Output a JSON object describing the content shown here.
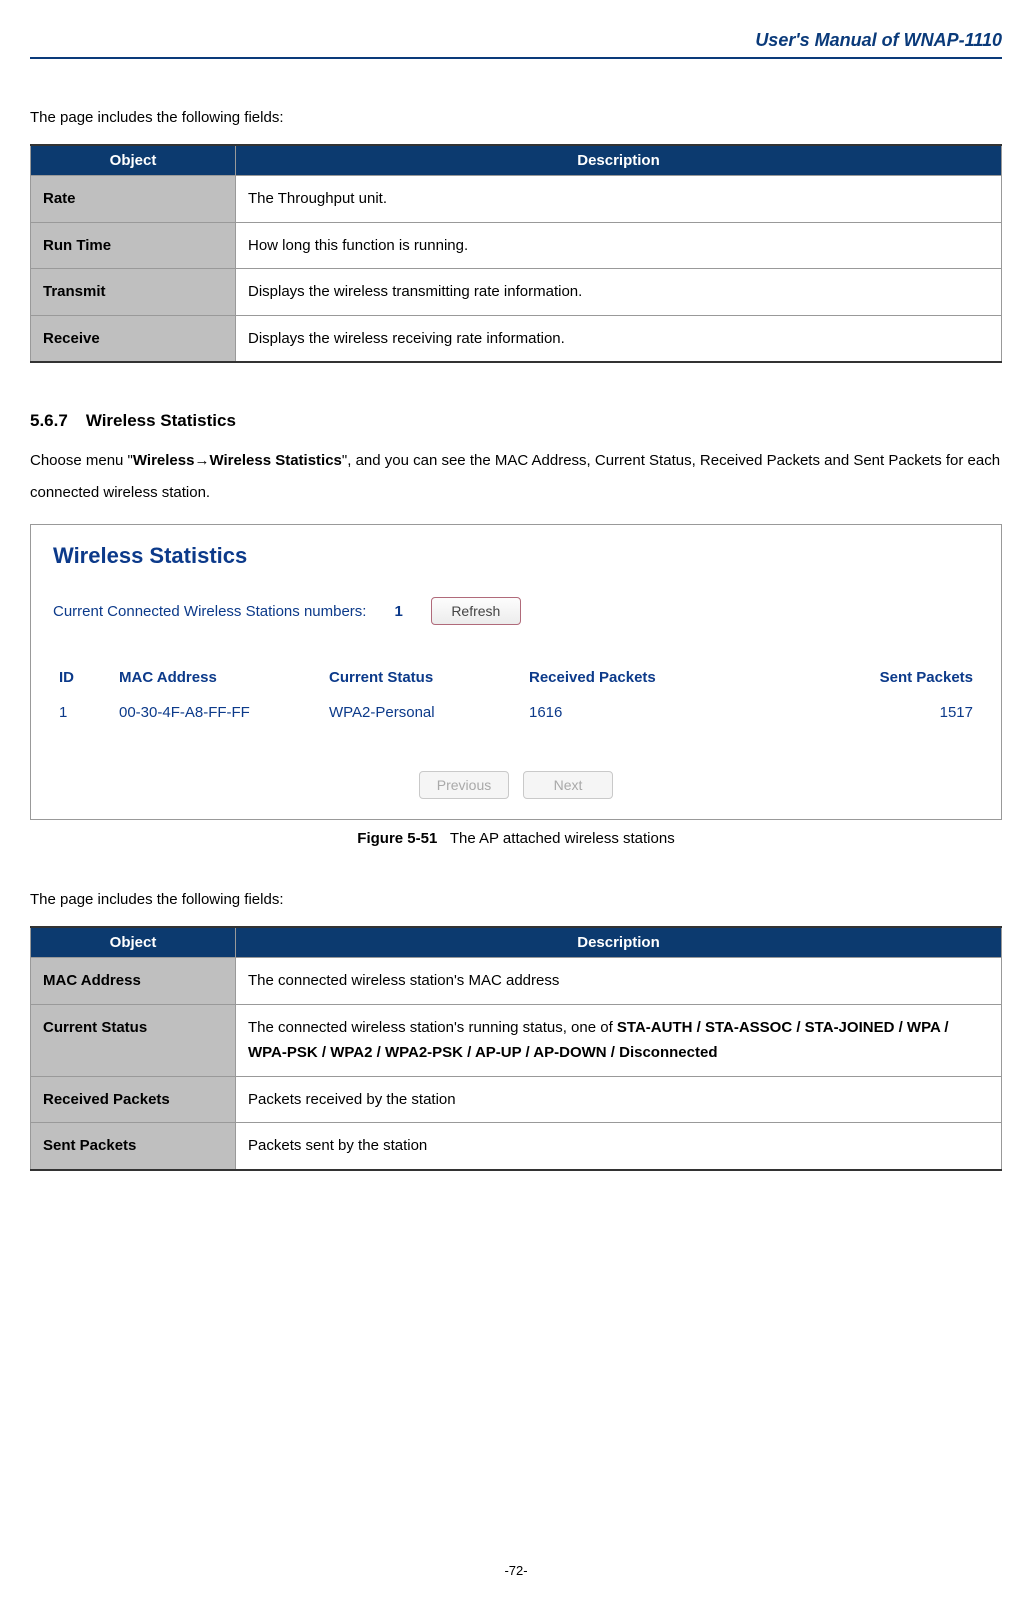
{
  "header": {
    "title": "User's Manual of WNAP-1110"
  },
  "intro1": "The page includes the following fields:",
  "table1": {
    "headers": {
      "object": "Object",
      "description": "Description"
    },
    "rows": [
      {
        "object": "Rate",
        "description": "The Throughput unit."
      },
      {
        "object": "Run Time",
        "description": "How long this function is running."
      },
      {
        "object": "Transmit",
        "description": "Displays the wireless transmitting rate information."
      },
      {
        "object": "Receive",
        "description": "Displays the wireless receiving rate information."
      }
    ]
  },
  "section": {
    "number": "5.6.7",
    "title": "Wireless Statistics",
    "para_pre": "Choose menu \"",
    "para_menu1": "Wireless",
    "para_arrow": "→",
    "para_menu2": "Wireless Statistics",
    "para_post": "\", and you can see the MAC Address, Current Status, Received Packets and Sent Packets for each connected wireless station."
  },
  "figure": {
    "title": "Wireless Statistics",
    "stations_label": "Current Connected Wireless Stations numbers:",
    "stations_count": "1",
    "refresh_label": "Refresh",
    "columns": {
      "id": "ID",
      "mac": "MAC Address",
      "status": "Current Status",
      "rx": "Received Packets",
      "tx": "Sent Packets"
    },
    "row": {
      "id": "1",
      "mac": "00-30-4F-A8-FF-FF",
      "status": "WPA2-Personal",
      "rx": "1616",
      "tx": "1517"
    },
    "prev_label": "Previous",
    "next_label": "Next",
    "caption_id": "Figure 5-51",
    "caption_text": "The AP attached wireless stations"
  },
  "intro2": "The page includes the following fields:",
  "table2": {
    "headers": {
      "object": "Object",
      "description": "Description"
    },
    "rows": [
      {
        "object": "MAC Address",
        "description_plain": "The connected wireless station's MAC address"
      },
      {
        "object": "Current Status",
        "description_pre": "The connected wireless station's running status, one of ",
        "description_bold": "STA-AUTH / STA-ASSOC / STA-JOINED / WPA / WPA-PSK / WPA2 / WPA2-PSK / AP-UP / AP-DOWN / Disconnected"
      },
      {
        "object": "Received Packets",
        "description_plain": "Packets received by the station"
      },
      {
        "object": "Sent Packets",
        "description_plain": "Packets sent by the station"
      }
    ]
  },
  "footer": {
    "page_number": "-72-"
  }
}
